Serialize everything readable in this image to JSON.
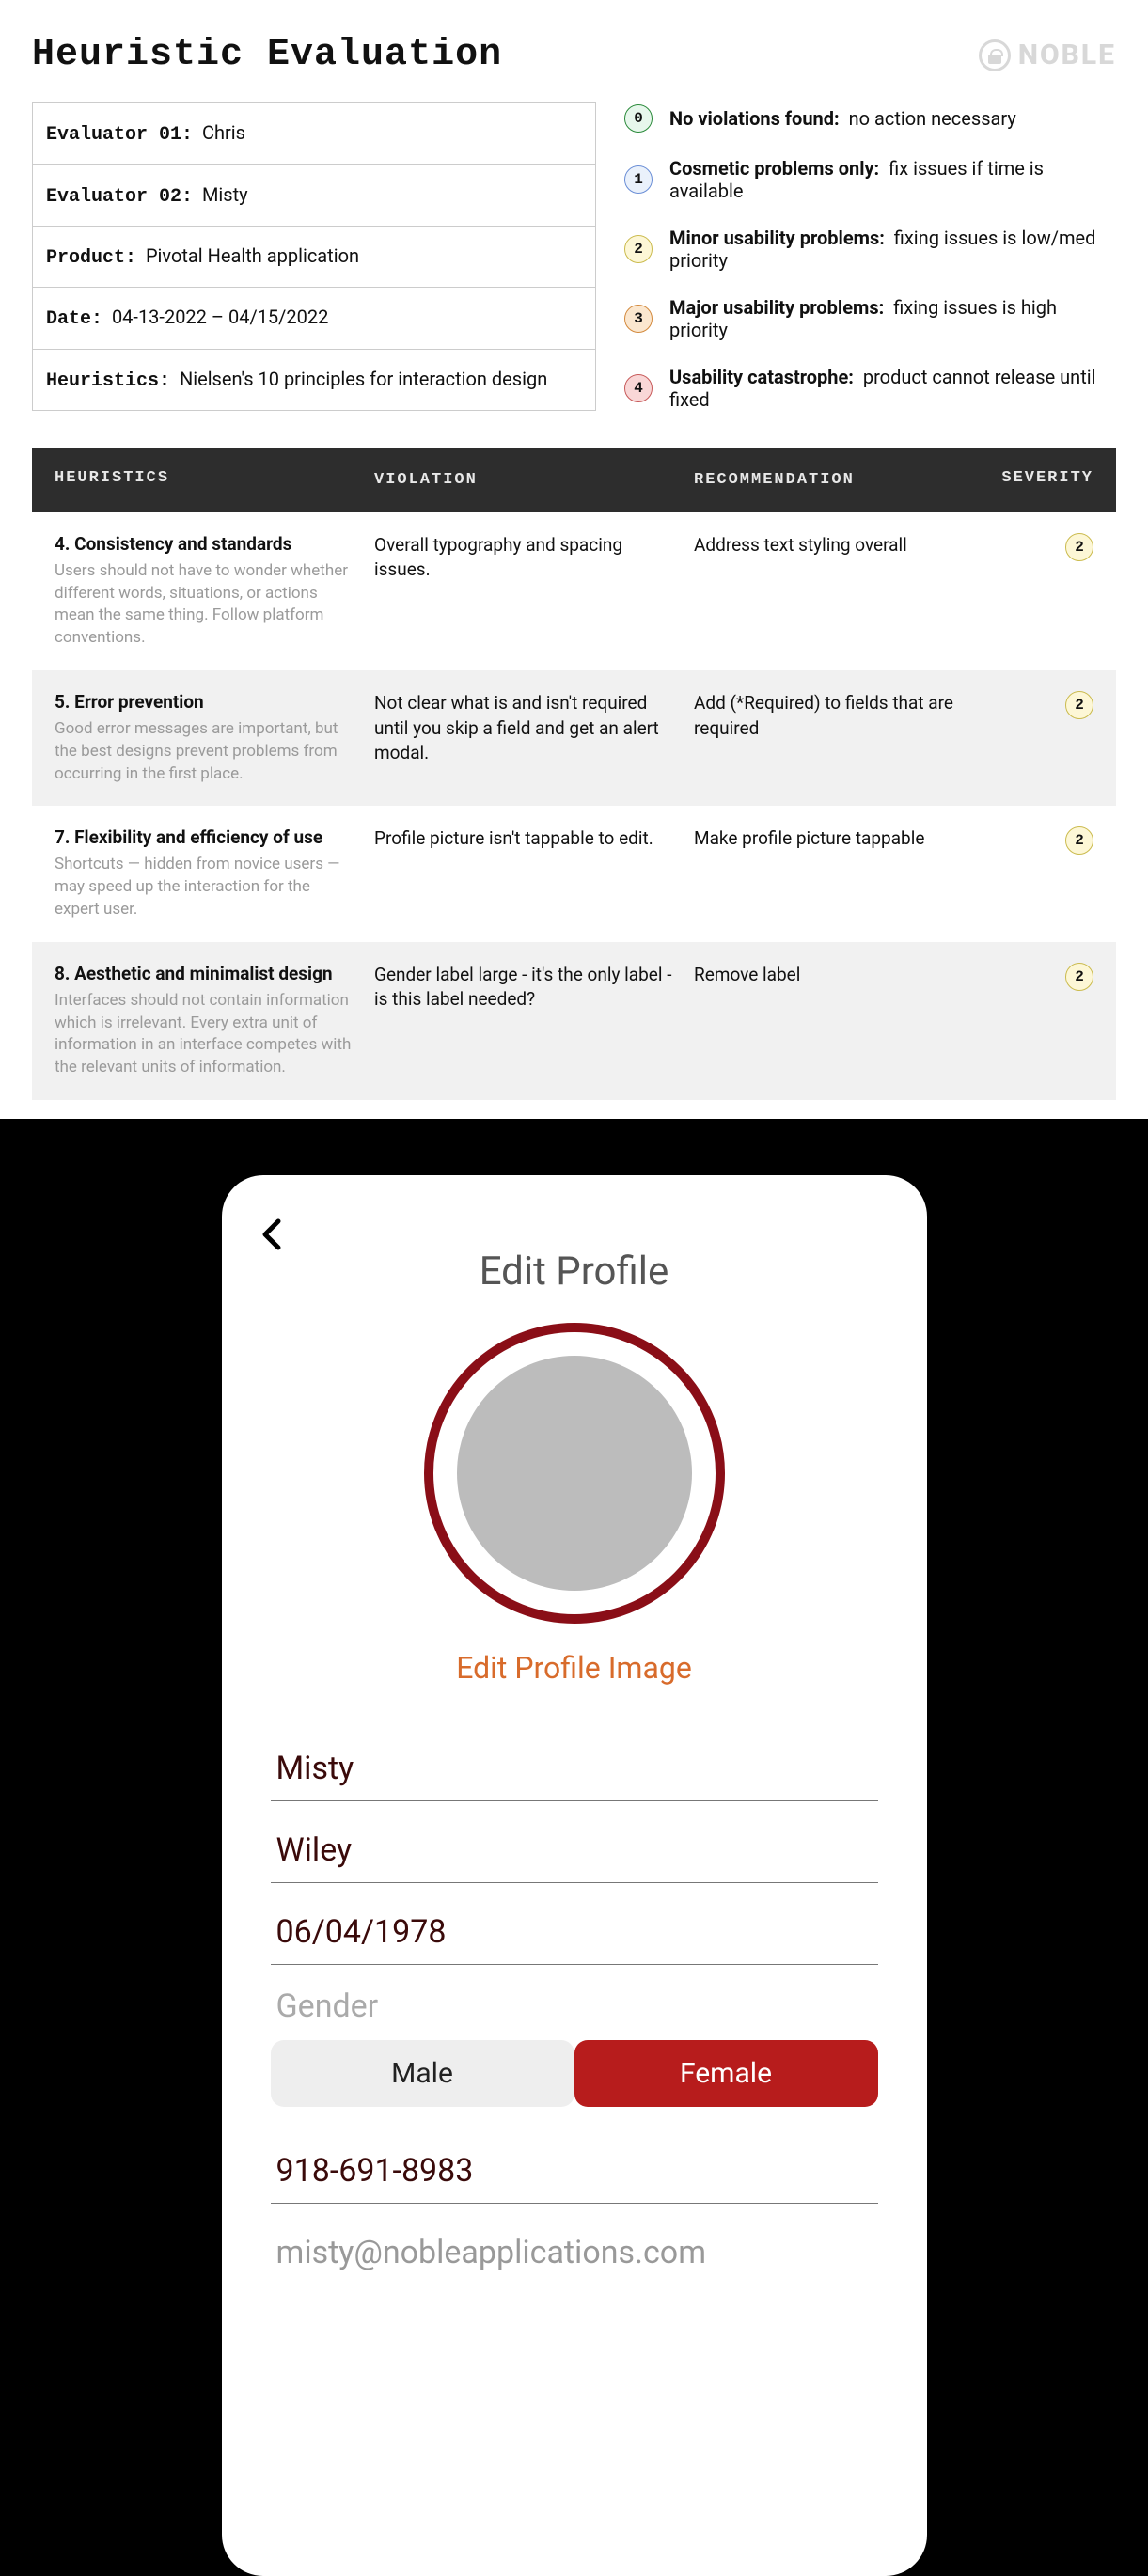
{
  "header": {
    "title": "Heuristic Evaluation",
    "brand": "NOBLE"
  },
  "meta": {
    "evaluator1_label": "Evaluator 01:",
    "evaluator1_value": "Chris",
    "evaluator2_label": "Evaluator 02:",
    "evaluator2_value": "Misty",
    "product_label": "Product:",
    "product_value": "Pivotal Health application",
    "date_label": "Date:",
    "date_value": "04-13-2022 – 04/15/2022",
    "heuristics_label": "Heuristics:",
    "heuristics_value": "Nielsen's 10 principles for interaction design"
  },
  "legend": [
    {
      "num": "0",
      "title": "No violations found:",
      "desc": "no action necessary"
    },
    {
      "num": "1",
      "title": "Cosmetic problems only:",
      "desc": "fix issues if time is available"
    },
    {
      "num": "2",
      "title": "Minor usability problems:",
      "desc": "fixing issues is low/med priority"
    },
    {
      "num": "3",
      "title": "Major usability problems:",
      "desc": "fixing issues is high priority"
    },
    {
      "num": "4",
      "title": "Usability catastrophe:",
      "desc": "product cannot release until fixed"
    }
  ],
  "columns": {
    "heuristics": "HEURISTICS",
    "violation": "VIOLATION",
    "recommendation": "RECOMMENDATION",
    "severity": "SEVERITY"
  },
  "rows": [
    {
      "title": "4. Consistency and standards",
      "desc": "Users should not have to wonder whether different words, situations, or actions mean the same thing. Follow platform conventions.",
      "violation": "Overall typography and spacing issues.",
      "recommendation": "Address text styling overall",
      "severity": "2"
    },
    {
      "title": "5. Error prevention",
      "desc": "Good error messages are important, but the best designs prevent problems from occurring in the first place.",
      "violation": "Not clear what is and isn't required until you skip a field and get an alert modal.",
      "recommendation": "Add (*Required) to fields that are required",
      "severity": "2"
    },
    {
      "title": "7. Flexibility and efficiency of use",
      "desc": "Shortcuts — hidden from novice users — may speed up the interaction for the expert user.",
      "violation": "Profile picture isn't tappable to edit.",
      "recommendation": "Make profile picture tappable",
      "severity": "2"
    },
    {
      "title": "8. Aesthetic and minimalist design",
      "desc": "Interfaces should not contain information which is irrelevant. Every extra unit of information in an interface competes with the relevant units of information.",
      "violation": "Gender label large - it's the only label  - is this label needed?",
      "recommendation": "Remove label",
      "severity": "2"
    }
  ],
  "phone": {
    "title": "Edit Profile",
    "edit_image": "Edit Profile Image",
    "first_name": "Misty",
    "last_name": "Wiley",
    "dob": "06/04/1978",
    "gender_label": "Gender",
    "male": "Male",
    "female": "Female",
    "phone_number": "918-691-8983",
    "email": "misty@nobleapplications.com"
  }
}
